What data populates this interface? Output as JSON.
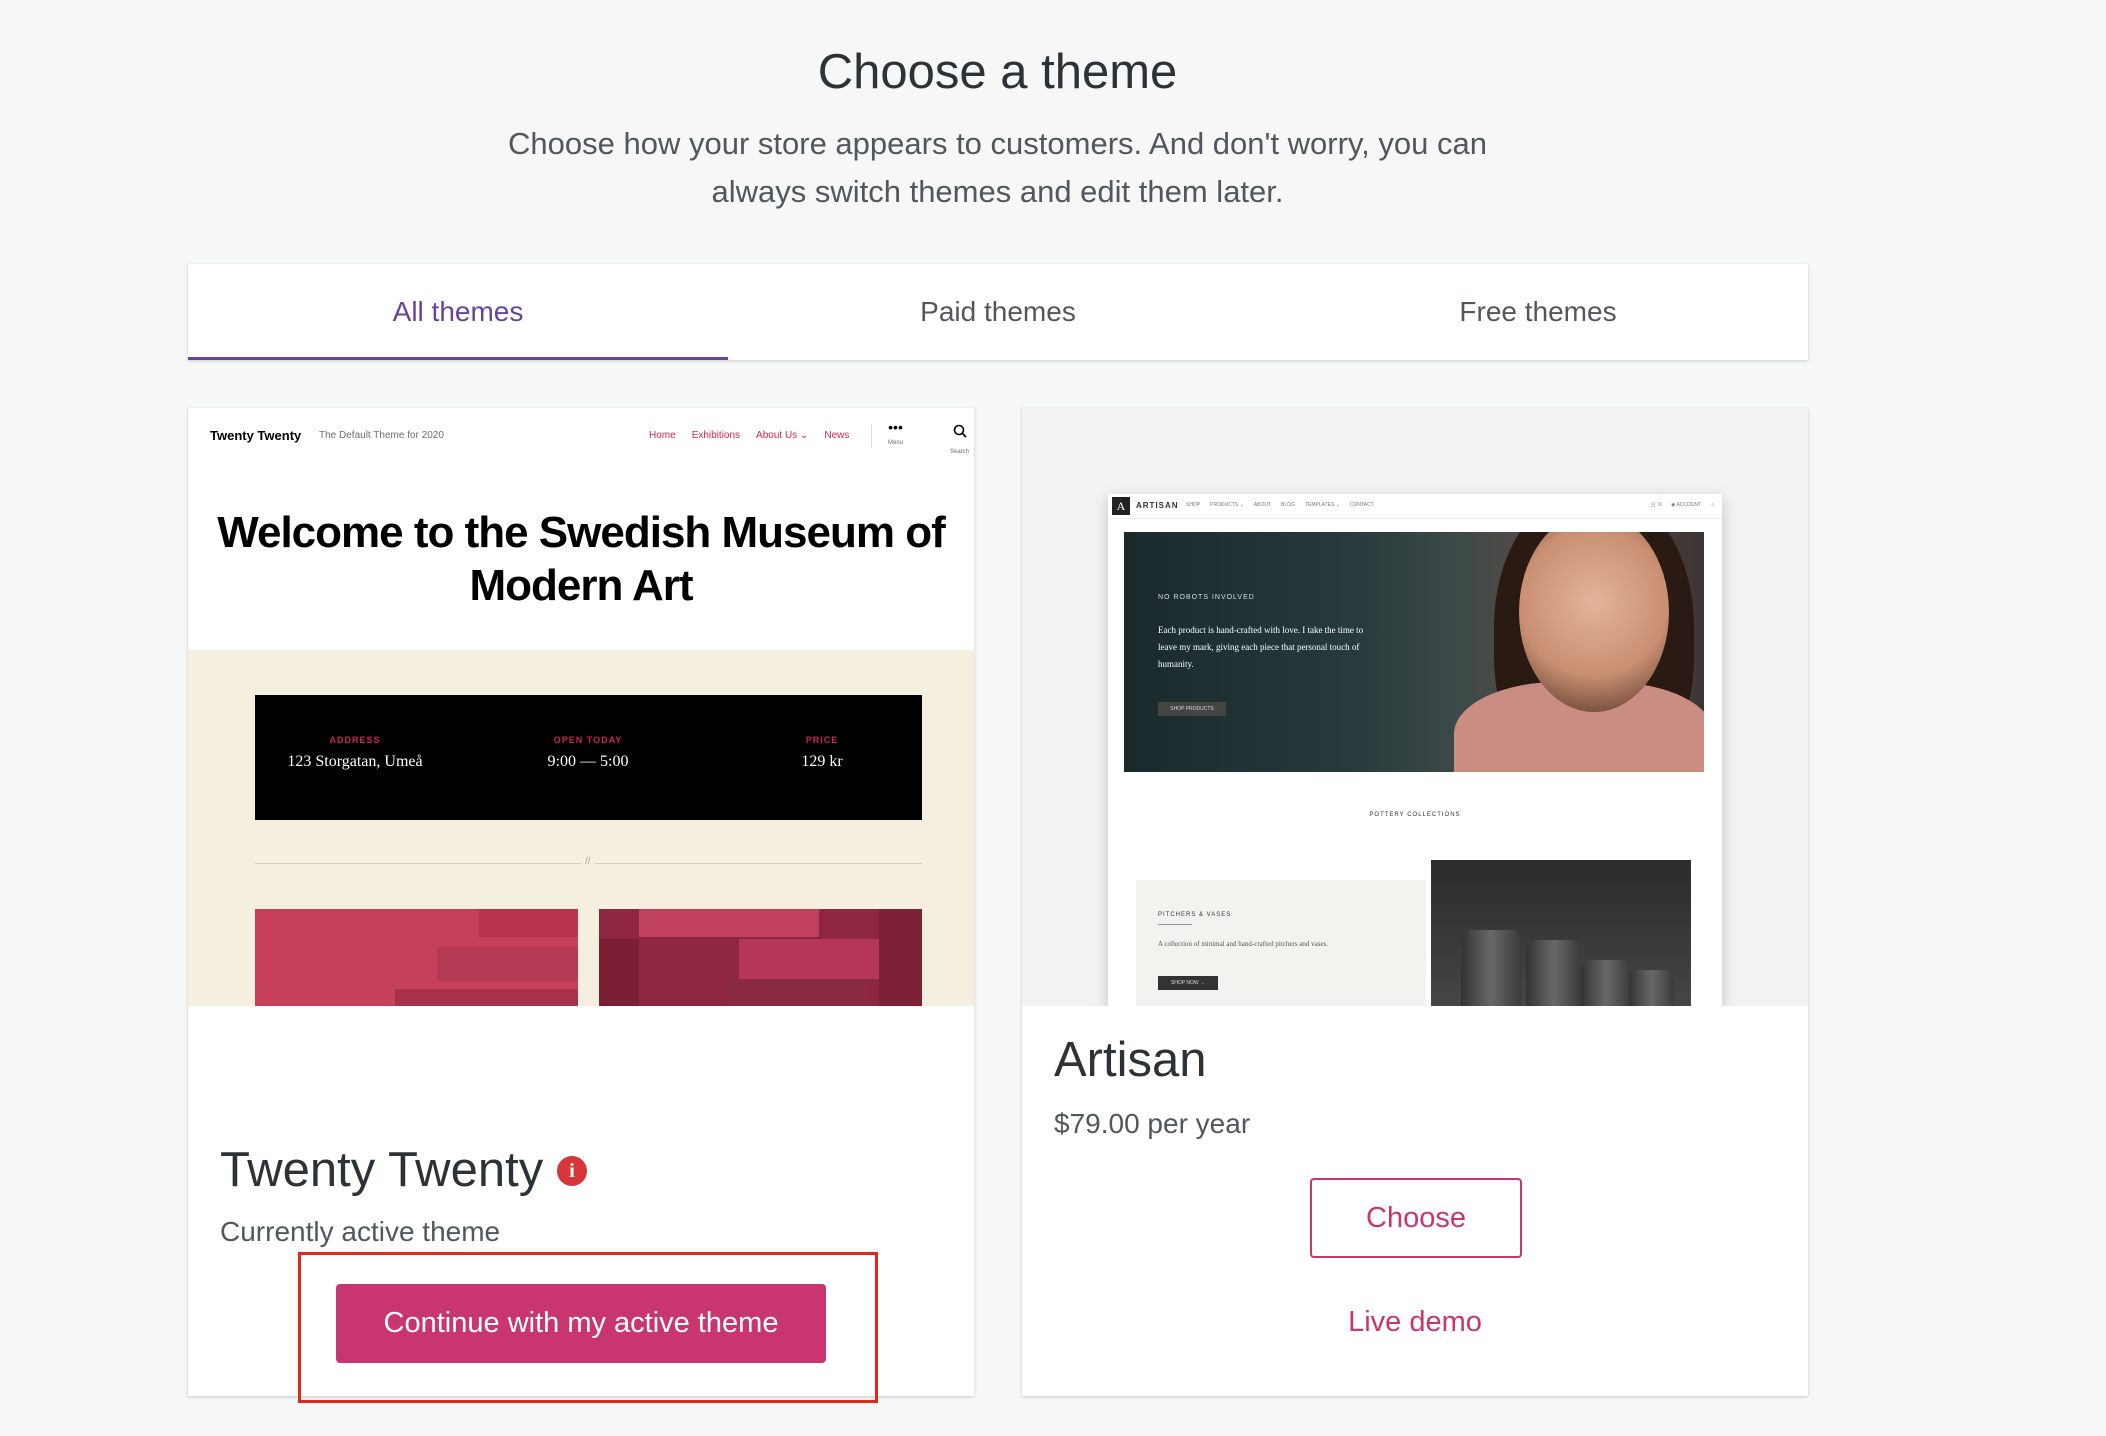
{
  "header": {
    "title": "Choose a theme",
    "subtitle": "Choose how your store appears to customers. And don't worry, you can always switch themes and edit them later."
  },
  "tabs": [
    {
      "label": "All themes",
      "active": true
    },
    {
      "label": "Paid themes",
      "active": false
    },
    {
      "label": "Free themes",
      "active": false
    }
  ],
  "themes": [
    {
      "name": "Twenty Twenty",
      "meta": "Currently active theme",
      "info_icon": "info-icon",
      "button_label": "Continue with my active theme",
      "preview": {
        "site_title": "Twenty Twenty",
        "tagline": "The Default Theme for 2020",
        "nav": [
          "Home",
          "Exhibitions",
          "About Us",
          "News"
        ],
        "menu_label": "Menu",
        "search_label": "Search",
        "hero": "Welcome to the Swedish Museum of Modern Art",
        "info": [
          {
            "label": "ADDRESS",
            "value": "123 Storgatan, Umeå"
          },
          {
            "label": "OPEN TODAY",
            "value": "9:00 — 5:00"
          },
          {
            "label": "PRICE",
            "value": "129 kr"
          }
        ],
        "rule_mark": "//"
      }
    },
    {
      "name": "Artisan",
      "meta": "$79.00 per year",
      "choose_label": "Choose",
      "demo_label": "Live demo",
      "preview": {
        "brand": "ARTISAN",
        "nav": [
          "SHOP",
          "PRODUCTS ⌄",
          "ABOUT",
          "BLOG",
          "TEMPLATES ⌄",
          "CONTACT"
        ],
        "nav_right": [
          "🛒 0",
          "◉ ACCOUNT",
          "⌕"
        ],
        "kicker": "NO ROBOTS INVOLVED",
        "copy": "Each product is hand-crafted with love. I take the time to leave my mark, giving each piece that personal touch of humanity.",
        "cta": "SHOP PRODUCTS",
        "section": "POTTERY COLLECTIONS",
        "panel_title": "PITCHERS & VASES",
        "panel_text": "A collection of minimal and hand-crafted pitchers and vases.",
        "panel_cta": "SHOP NOW →"
      }
    }
  ],
  "colors": {
    "accent": "#c9356e",
    "tab_active": "#674399",
    "tt_red": "#cd2653",
    "tt_cream": "#f5efe0",
    "highlight": "#e0281d"
  }
}
